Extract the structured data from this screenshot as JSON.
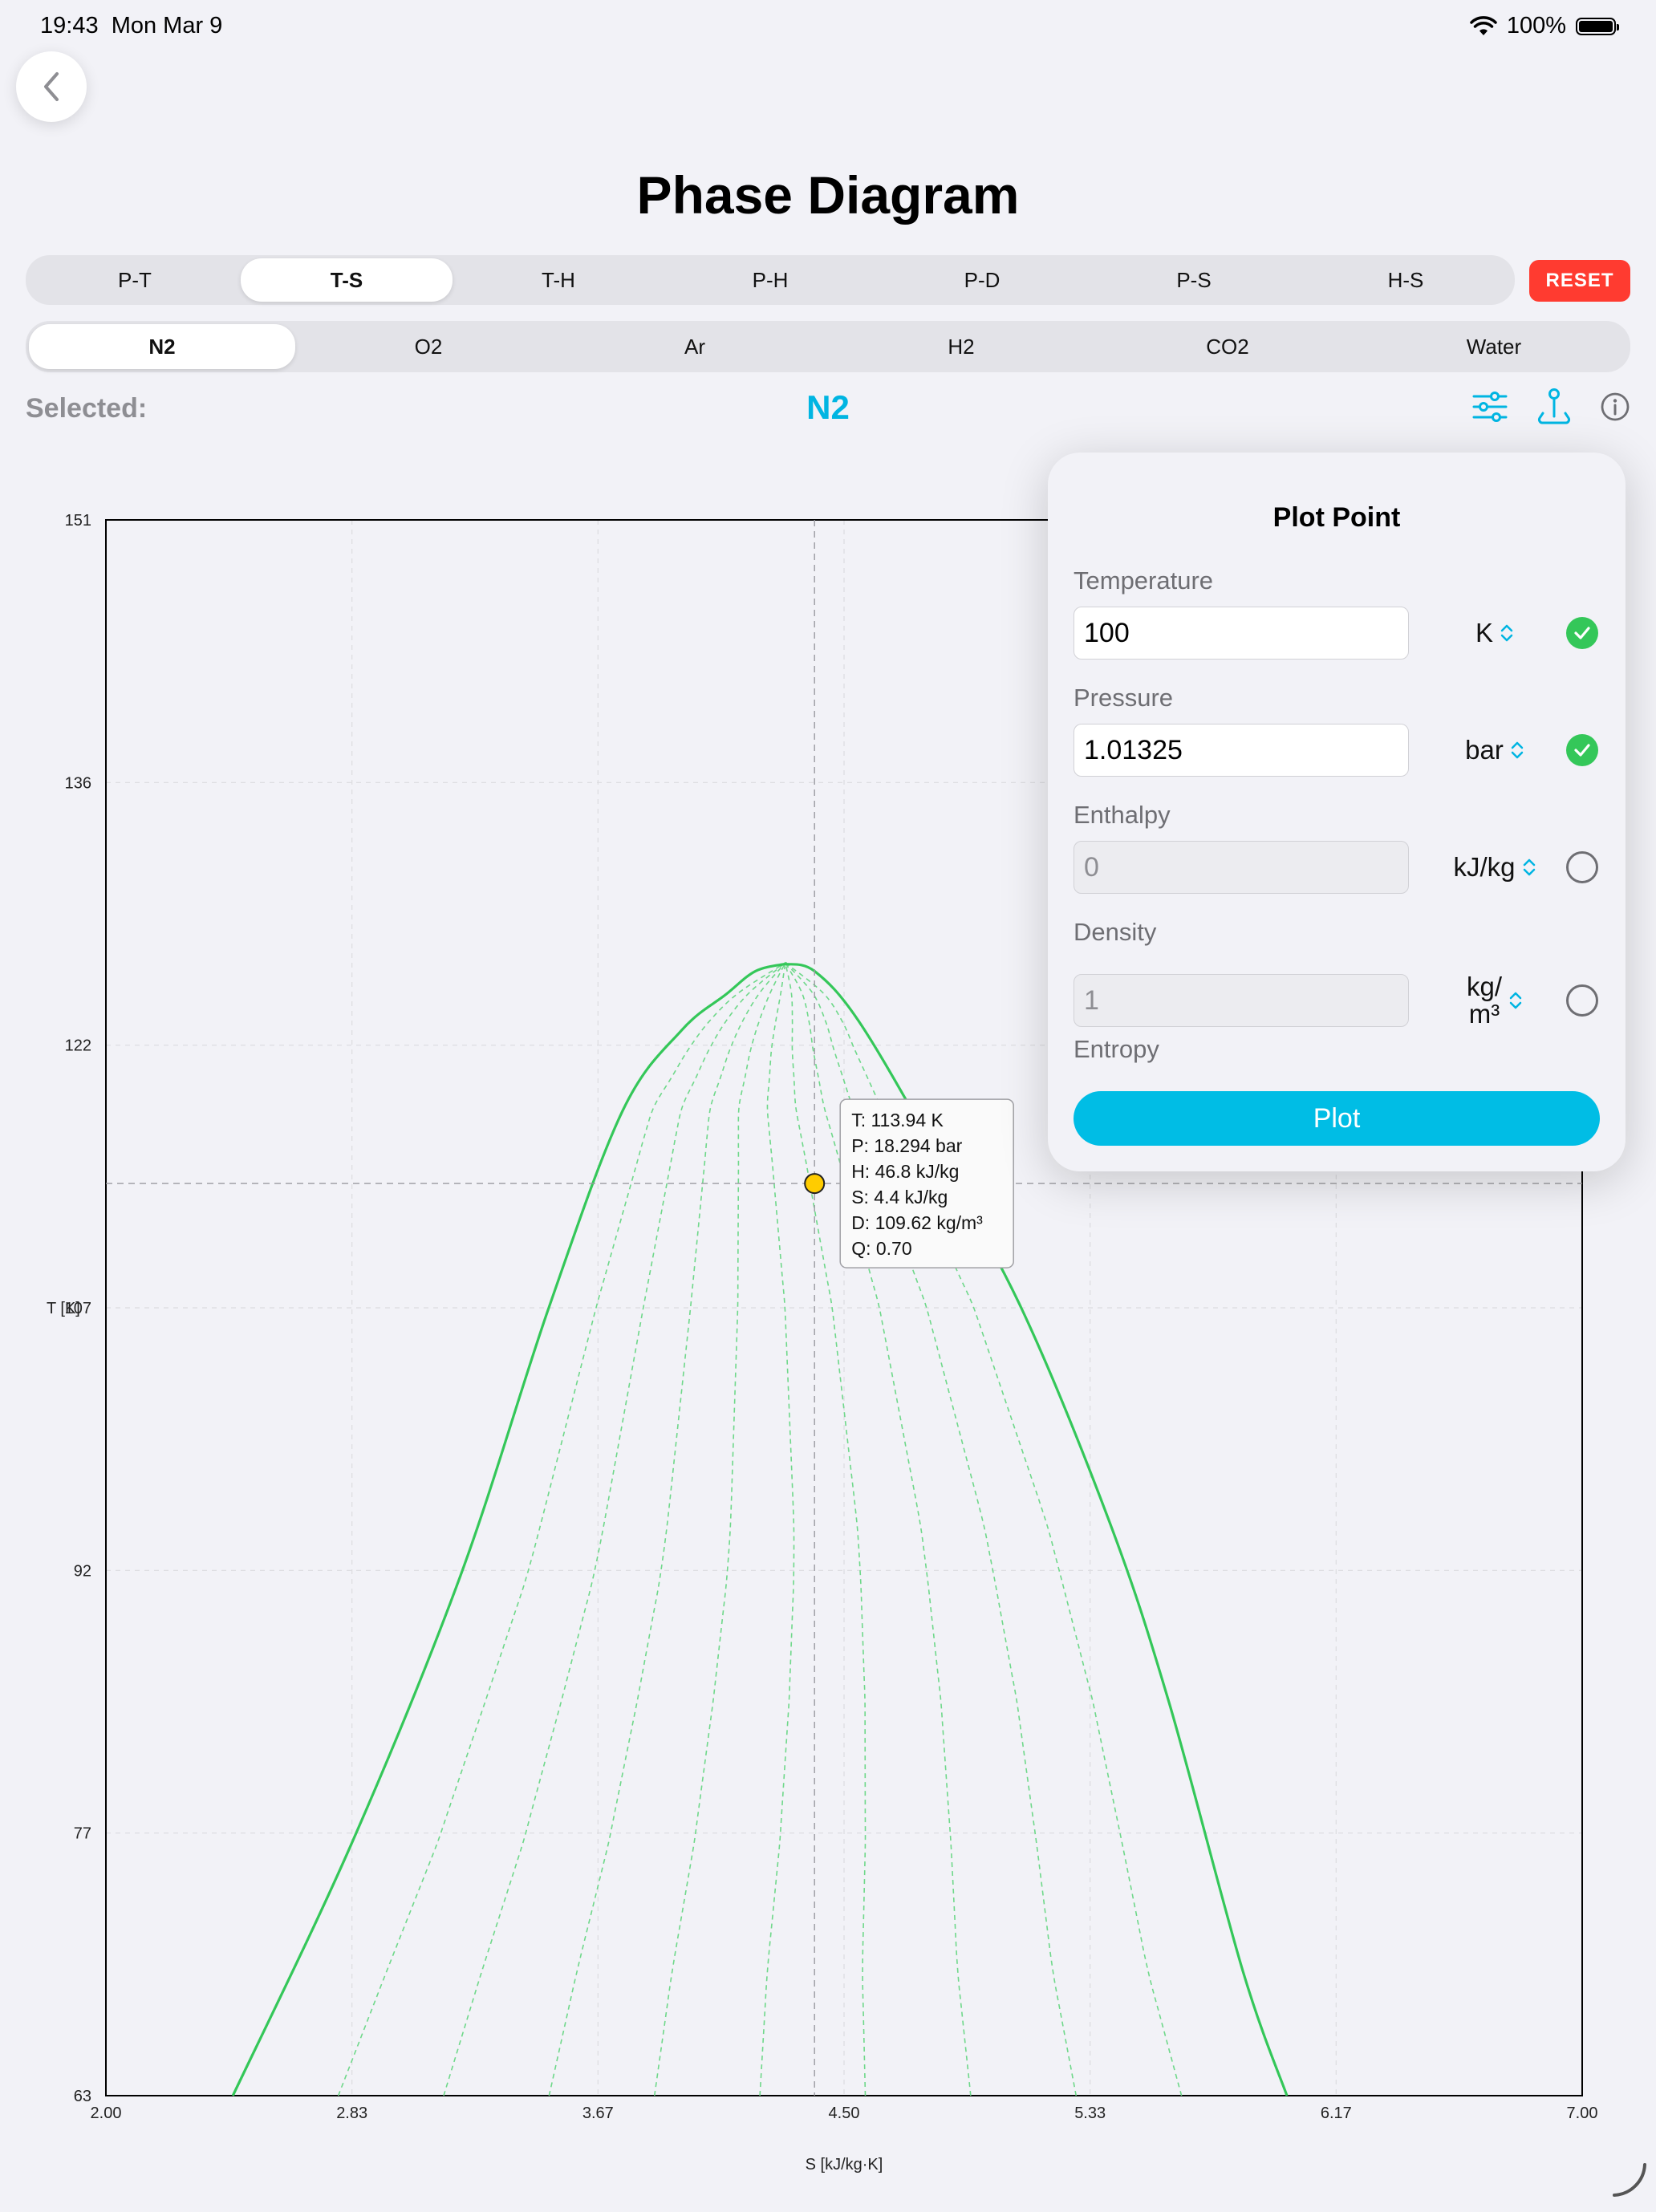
{
  "status_bar": {
    "time": "19:43",
    "date": "Mon Mar 9",
    "battery": "100%"
  },
  "title": "Phase Diagram",
  "diagram_tabs": [
    {
      "label": "P-T",
      "active": false
    },
    {
      "label": "T-S",
      "active": true
    },
    {
      "label": "T-H",
      "active": false
    },
    {
      "label": "P-H",
      "active": false
    },
    {
      "label": "P-D",
      "active": false
    },
    {
      "label": "P-S",
      "active": false
    },
    {
      "label": "H-S",
      "active": false
    }
  ],
  "reset_label": "RESET",
  "fluid_tabs": [
    {
      "label": "N2",
      "active": true
    },
    {
      "label": "O2",
      "active": false
    },
    {
      "label": "Ar",
      "active": false
    },
    {
      "label": "H2",
      "active": false
    },
    {
      "label": "CO2",
      "active": false
    },
    {
      "label": "Water",
      "active": false
    }
  ],
  "selected_label": "Selected:",
  "selected_value": "N2",
  "icons": {
    "back": "chevron-left-icon",
    "settings": "sliders-icon",
    "plot": "joystick-pin-icon",
    "info": "info-icon"
  },
  "colors": {
    "accent": "#00b5e2",
    "curve": "#34c759",
    "point": "#ffcc00",
    "reset": "#ff3b30"
  },
  "chart_data": {
    "type": "line",
    "xlabel": "S [kJ/kg·K]",
    "ylabel": "T [K]",
    "xlim": [
      2.0,
      7.0
    ],
    "ylim": [
      63,
      151
    ],
    "x_ticks": [
      "2.00",
      "2.83",
      "3.67",
      "4.50",
      "5.33",
      "6.17",
      "7.00"
    ],
    "y_ticks": [
      "151",
      "136",
      "122",
      "107",
      "92",
      "77",
      "63"
    ],
    "grid": true,
    "critical_point": {
      "s": 4.3,
      "T": 126.2
    },
    "saturation_dome": {
      "liquid_left": {
        "s": [
          2.43,
          2.83,
          3.2,
          3.5,
          3.75,
          3.95,
          4.1,
          4.2,
          4.3
        ],
        "T": [
          63,
          77,
          92,
          107,
          118,
          122.5,
          124.5,
          125.8,
          126.2
        ]
      },
      "vapor_right": {
        "s": [
          4.3,
          4.4,
          4.55,
          4.8,
          5.1,
          5.4,
          5.6,
          5.85,
          6.0
        ],
        "T": [
          126.2,
          125.8,
          123,
          116,
          107,
          95,
          85,
          70,
          63
        ]
      }
    },
    "quality_lines": {
      "quality_values": [
        0.1,
        0.2,
        0.3,
        0.4,
        0.5,
        0.6,
        0.7,
        0.8,
        0.9
      ],
      "style": "dashed"
    },
    "marker": {
      "s": 4.4,
      "T": 113.94
    },
    "tooltip": [
      "T: 113.94 K",
      "P: 18.294 bar",
      "H: 46.8 kJ/kg",
      "S: 4.4 kJ/kg",
      "D: 109.62 kg/m³",
      "Q: 0.70"
    ]
  },
  "plot_point": {
    "title": "Plot Point",
    "fields": [
      {
        "label": "Temperature",
        "value": "100",
        "unit": "K",
        "checked": true,
        "enabled": true
      },
      {
        "label": "Pressure",
        "value": "1.01325",
        "unit": "bar",
        "checked": true,
        "enabled": true
      },
      {
        "label": "Enthalpy",
        "value": "0",
        "unit": "kJ/kg",
        "checked": false,
        "enabled": false
      },
      {
        "label": "Density",
        "value": "1",
        "unit_line1": "kg/",
        "unit_line2": "m³",
        "checked": false,
        "enabled": false
      }
    ],
    "entropy_label": "Entropy",
    "plot_button": "Plot"
  }
}
